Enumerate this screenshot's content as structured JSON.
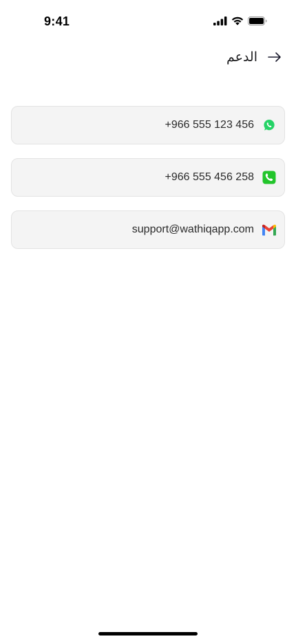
{
  "status_bar": {
    "time": "9:41"
  },
  "header": {
    "title": "الدعم",
    "back_icon": "arrow-right-icon"
  },
  "contacts": [
    {
      "type": "whatsapp",
      "icon": "whatsapp-icon",
      "value": "+966 555 123 456",
      "icon_color": "#25D366"
    },
    {
      "type": "phone",
      "icon": "phone-icon",
      "value": "+966 555 456 258",
      "icon_color": "#22C52B"
    },
    {
      "type": "email",
      "icon": "gmail-icon",
      "value": "support@wathiqapp.com"
    }
  ]
}
